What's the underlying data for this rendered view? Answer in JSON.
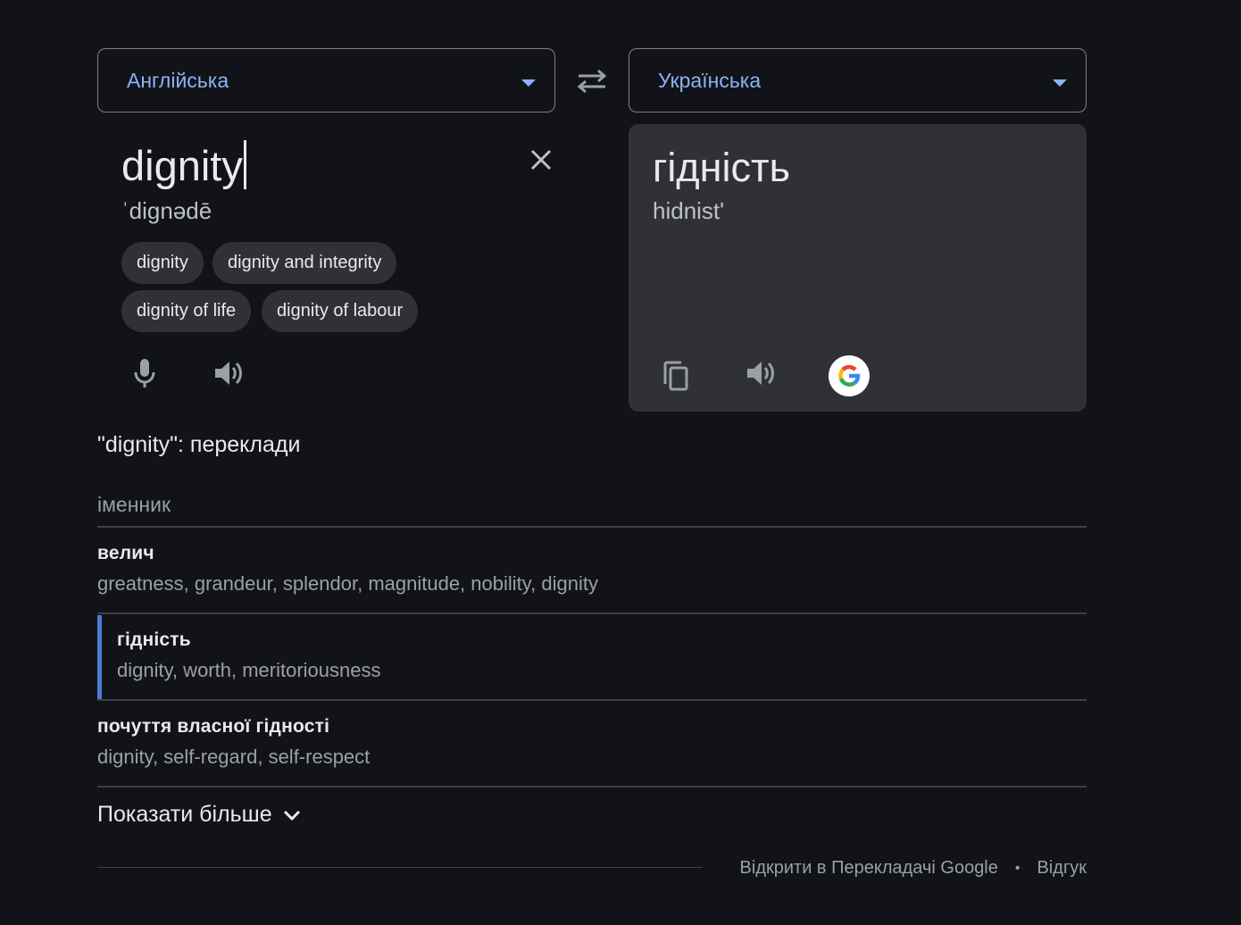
{
  "source_lang": {
    "label": "Англійська",
    "icon": "chevron-down-icon"
  },
  "target_lang": {
    "label": "Українська",
    "icon": "chevron-down-icon"
  },
  "swap": {
    "icon": "swap-arrows-icon"
  },
  "source": {
    "text": "dignity",
    "transliteration": "ˈdiɡnədē",
    "clear_icon": "close-icon",
    "suggestions": [
      "dignity",
      "dignity and integrity",
      "dignity of life",
      "dignity of labour"
    ],
    "mic_icon": "microphone-icon",
    "listen_icon": "speaker-icon"
  },
  "result": {
    "text": "гідність",
    "transliteration": "hidnistʹ",
    "copy_icon": "copy-icon",
    "listen_icon": "speaker-icon",
    "google_icon": "google-logo-icon"
  },
  "translations": {
    "heading": "\"dignity\": переклади",
    "pos": "іменник",
    "entries": [
      {
        "term": "велич",
        "synonyms": "greatness, grandeur, splendor, magnitude, nobility, dignity"
      },
      {
        "term": "гідність",
        "synonyms": "dignity, worth, meritoriousness"
      },
      {
        "term": "почуття власної гідності",
        "synonyms": "dignity, self-regard, self-respect"
      }
    ],
    "show_more": "Показати більше"
  },
  "footer": {
    "open_link": "Відкрити в Перекладачі Google",
    "separator": "•",
    "feedback_link": "Відгук"
  },
  "colors": {
    "background": "#121318",
    "card": "#303136",
    "accent": "#8ab4f8",
    "active_bar": "#4d7cd1"
  }
}
